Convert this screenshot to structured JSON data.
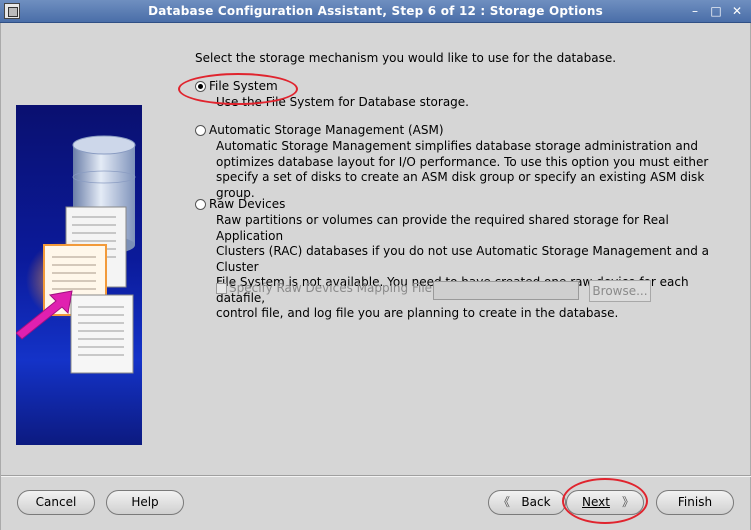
{
  "window": {
    "title": "Database Configuration Assistant, Step 6 of 12 : Storage Options",
    "controls": [
      "–",
      "□",
      "✕"
    ]
  },
  "main": {
    "instruction": "Select the storage mechanism you would like to use for the database.",
    "options": [
      {
        "label": "File System",
        "selected": true,
        "description": [
          "Use the File System for Database storage."
        ]
      },
      {
        "label": "Automatic Storage Management (ASM)",
        "selected": false,
        "description": [
          "Automatic Storage Management simplifies database storage administration and",
          "optimizes database layout for I/O performance. To use this option you must either",
          "specify a set of disks to create an ASM disk group or specify an existing ASM disk group."
        ]
      },
      {
        "label": "Raw Devices",
        "selected": false,
        "description": [
          "Raw partitions or volumes can provide the required shared storage for Real Application",
          "Clusters (RAC) databases if you do not use Automatic Storage Management and a Cluster",
          "File System is not available.  You need to have created one raw device for each datafile,",
          "control file, and log file you are planning to create in the database."
        ]
      }
    ],
    "raw_mapping": {
      "checkbox_label": "Specify Raw Devices Mapping File",
      "checked": false,
      "field_value": "",
      "browse_label": "Browse..."
    },
    "illustration": {
      "doc_text": "Vfdsfdfsfdkjhfdsf"
    }
  },
  "footer": {
    "cancel": "Cancel",
    "help": "Help",
    "back": "Back",
    "next": "Next",
    "finish": "Finish"
  },
  "colors": {
    "annotation": "#e0242e",
    "titlebar": "#4a6ea8",
    "art_bg": "#0b1a9a"
  }
}
